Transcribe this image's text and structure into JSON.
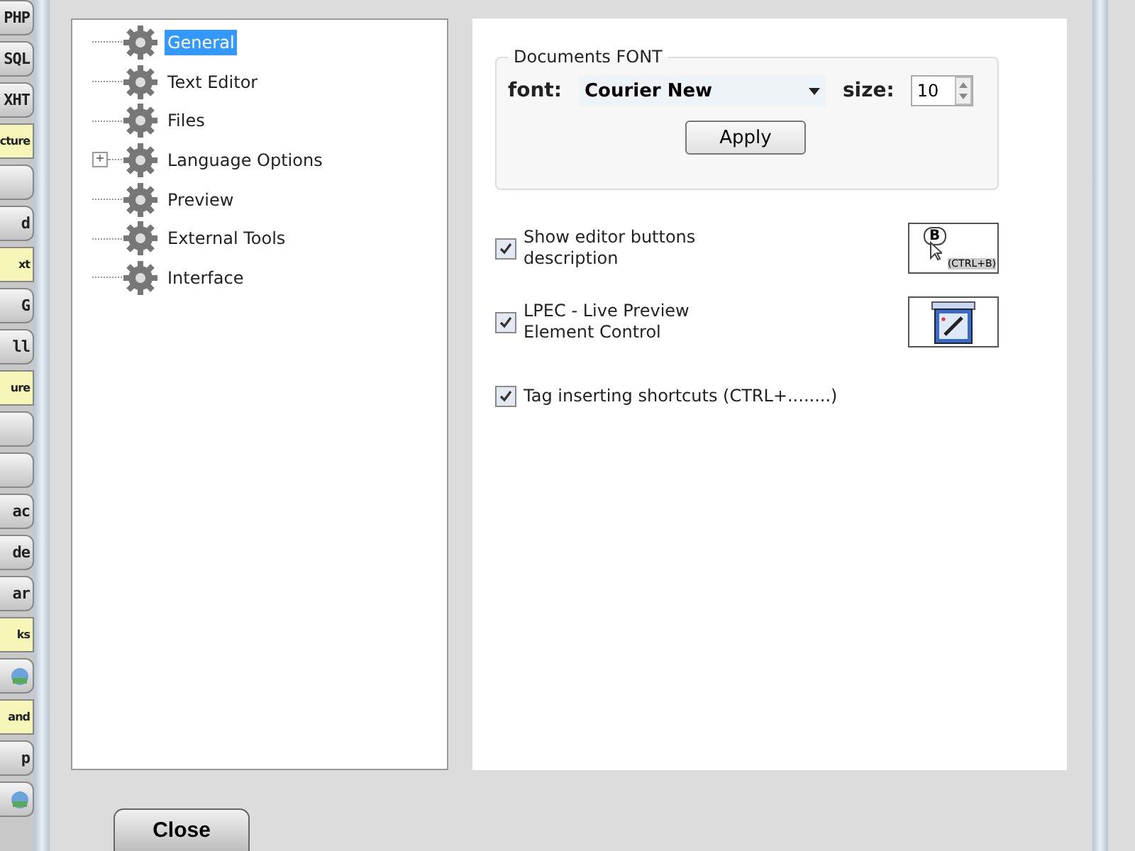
{
  "background_strip": [
    {
      "kind": "button",
      "text": "PHP"
    },
    {
      "kind": "button",
      "text": "SQL"
    },
    {
      "kind": "button",
      "text": "XHT"
    },
    {
      "kind": "label",
      "text": "cture"
    },
    {
      "kind": "blank-button"
    },
    {
      "kind": "button",
      "text": "d"
    },
    {
      "kind": "label",
      "text": "xt"
    },
    {
      "kind": "button",
      "text": "G"
    },
    {
      "kind": "button",
      "text": "ll"
    },
    {
      "kind": "label",
      "text": "ure"
    },
    {
      "kind": "blank-button"
    },
    {
      "kind": "blank-button"
    },
    {
      "kind": "button",
      "text": "ac"
    },
    {
      "kind": "button",
      "text": "de"
    },
    {
      "kind": "button",
      "text": "ar"
    },
    {
      "kind": "label",
      "text": "ks"
    },
    {
      "kind": "icon-button"
    },
    {
      "kind": "label",
      "text": "and"
    },
    {
      "kind": "button",
      "text": "p"
    },
    {
      "kind": "icon-button"
    }
  ],
  "tree": [
    {
      "label": "General",
      "selected": true
    },
    {
      "label": "Text Editor",
      "selected": false
    },
    {
      "label": "Files",
      "selected": false
    },
    {
      "label": "Language Options",
      "selected": false,
      "expander": "+"
    },
    {
      "label": "Preview",
      "selected": false
    },
    {
      "label": "External Tools",
      "selected": false
    },
    {
      "label": "Interface",
      "selected": false
    }
  ],
  "font_group": {
    "title": "Documents FONT",
    "font_label": "font:",
    "font_value": "Courier New",
    "size_label": "size:",
    "size_value": "10",
    "apply": "Apply"
  },
  "options": [
    {
      "label": "Show editor buttons description",
      "checked": true,
      "kind": "tooltip",
      "preview_text": "B",
      "preview_hint": "(CTRL+B)"
    },
    {
      "label": "LPEC - Live Preview Element Control",
      "checked": true,
      "kind": "lpec"
    },
    {
      "label": "Tag inserting shortcuts (CTRL+........)",
      "checked": true
    }
  ],
  "close": "Close"
}
